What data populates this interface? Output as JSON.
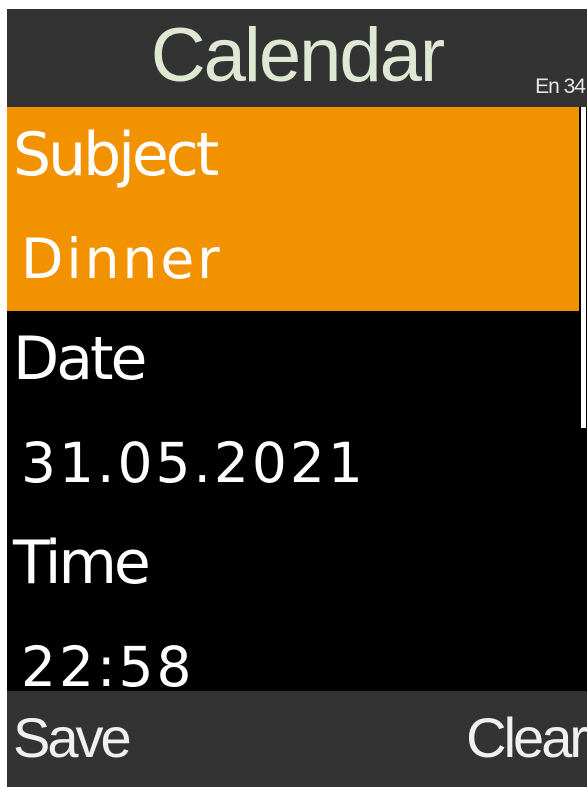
{
  "header": {
    "title": "Calendar",
    "input_indicator": "En 34"
  },
  "fields": [
    {
      "label": "Subject",
      "value": "Dinner",
      "selected": true
    },
    {
      "label": "Date",
      "value": "31.05.2021",
      "selected": false
    },
    {
      "label": "Time",
      "value": "22:58",
      "selected": false
    }
  ],
  "scrollbar": {
    "visible_fraction": 0.55,
    "position_fraction": 0.0
  },
  "softkeys": {
    "left": "Save",
    "right": "Clear"
  },
  "colors": {
    "selection": "#f39201",
    "bar_background": "#333333",
    "screen_background": "#000000",
    "title_text": "#dfe8d2"
  }
}
